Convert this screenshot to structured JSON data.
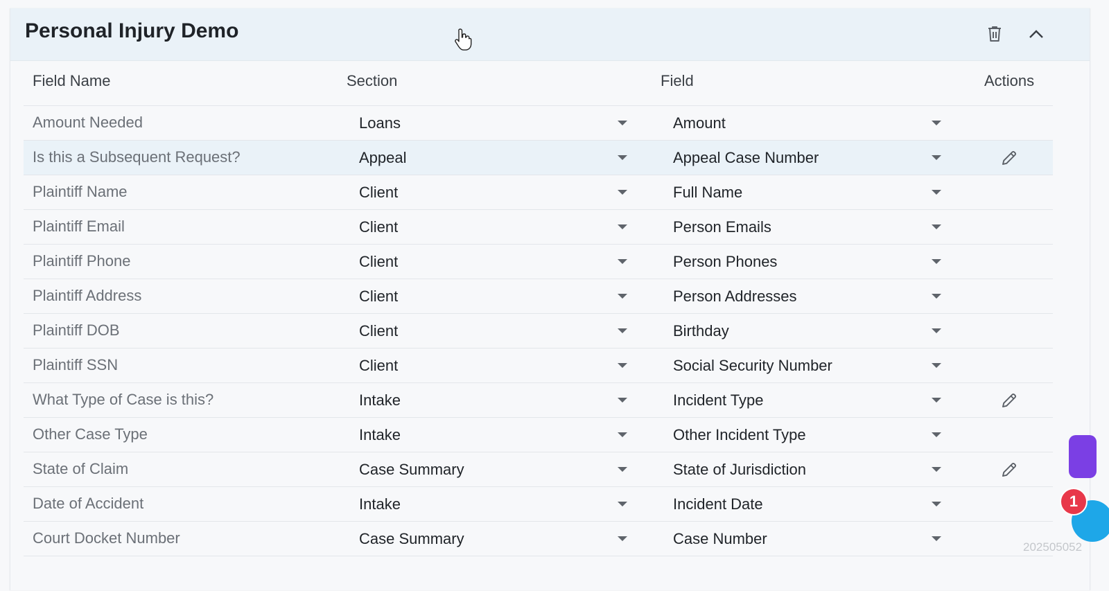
{
  "header": {
    "title": "Personal Injury Demo"
  },
  "columns": {
    "field_name": "Field Name",
    "section": "Section",
    "field": "Field",
    "actions": "Actions"
  },
  "rows": [
    {
      "field_name": "Amount Needed",
      "section": "Loans",
      "field": "Amount",
      "editable": false
    },
    {
      "field_name": "Is this a Subsequent Request?",
      "section": "Appeal",
      "field": "Appeal Case Number",
      "editable": true
    },
    {
      "field_name": "Plaintiff Name",
      "section": "Client",
      "field": "Full Name",
      "editable": false
    },
    {
      "field_name": "Plaintiff Email",
      "section": "Client",
      "field": "Person Emails",
      "editable": false
    },
    {
      "field_name": "Plaintiff Phone",
      "section": "Client",
      "field": "Person Phones",
      "editable": false
    },
    {
      "field_name": "Plaintiff Address",
      "section": "Client",
      "field": "Person Addresses",
      "editable": false
    },
    {
      "field_name": "Plaintiff DOB",
      "section": "Client",
      "field": "Birthday",
      "editable": false
    },
    {
      "field_name": "Plaintiff SSN",
      "section": "Client",
      "field": "Social Security Number",
      "editable": false
    },
    {
      "field_name": "What Type of Case is this?",
      "section": "Intake",
      "field": "Incident Type",
      "editable": true
    },
    {
      "field_name": "Other Case Type",
      "section": "Intake",
      "field": "Other Incident Type",
      "editable": false
    },
    {
      "field_name": "State of Claim",
      "section": "Case Summary",
      "field": "State of Jurisdiction",
      "editable": true
    },
    {
      "field_name": "Date of Accident",
      "section": "Intake",
      "field": "Incident Date",
      "editable": false
    },
    {
      "field_name": "Court Docket Number",
      "section": "Case Summary",
      "field": "Case Number",
      "editable": false
    }
  ],
  "icons": {
    "delete": "trash-icon",
    "collapse": "chevron-up-icon",
    "edit": "pencil-icon",
    "dropdown": "caret-down-icon"
  },
  "notification": {
    "count": "1"
  },
  "watermark": "202505052",
  "colors": {
    "header_bg": "#eaf2f8",
    "chat_button": "#7b3fe4",
    "badge": "#e8384a"
  }
}
